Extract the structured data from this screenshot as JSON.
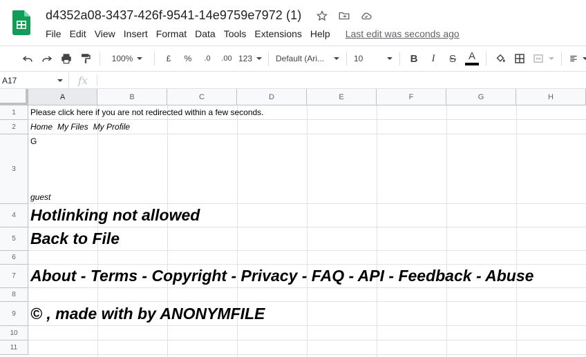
{
  "window": {
    "doc_title": "d4352a08-3437-426f-9541-14e9759e7972 (1)",
    "last_edit": "Last edit was seconds ago",
    "icons": [
      "star-icon",
      "move-to-folder-icon",
      "cloud-status-icon"
    ]
  },
  "menu": [
    "File",
    "Edit",
    "View",
    "Insert",
    "Format",
    "Data",
    "Tools",
    "Extensions",
    "Help"
  ],
  "toolbar": {
    "zoom": "100%",
    "currency": "£",
    "percent": "%",
    "decrease_decimal": ".0",
    "increase_decimal": ".00",
    "more_formats": "123",
    "font": "Default (Ari...",
    "font_size": "10",
    "bold": "B",
    "italic": "I",
    "strike": "S",
    "text_color": "A",
    "text_color_value": "#000000"
  },
  "formula_bar": {
    "name_box": "A17",
    "fx": "fx",
    "value": ""
  },
  "columns": [
    "A",
    "B",
    "C",
    "D",
    "E",
    "F",
    "G",
    "H"
  ],
  "rows": [
    "1",
    "2",
    "3",
    "4",
    "5",
    "6",
    "7",
    "8",
    "9",
    "10",
    "11"
  ],
  "cells": {
    "r1": "Please click here if you are not redirected within a few seconds.",
    "r2_links": [
      "Home",
      "My Files",
      "My Profile"
    ],
    "r3_top": "G",
    "r3_bottom": "guest",
    "r4": "Hotlinking not allowed",
    "r5": "Back to File",
    "r7": "About - Terms - Copyright - Privacy - FAQ - API - Feedback - Abuse",
    "r9": "© , made with  by  ANONYMFILE"
  },
  "colors": {
    "sheets_green": "#0f9d58",
    "header_bg": "#f8f9fa",
    "grid_line": "#e2e2e2"
  }
}
